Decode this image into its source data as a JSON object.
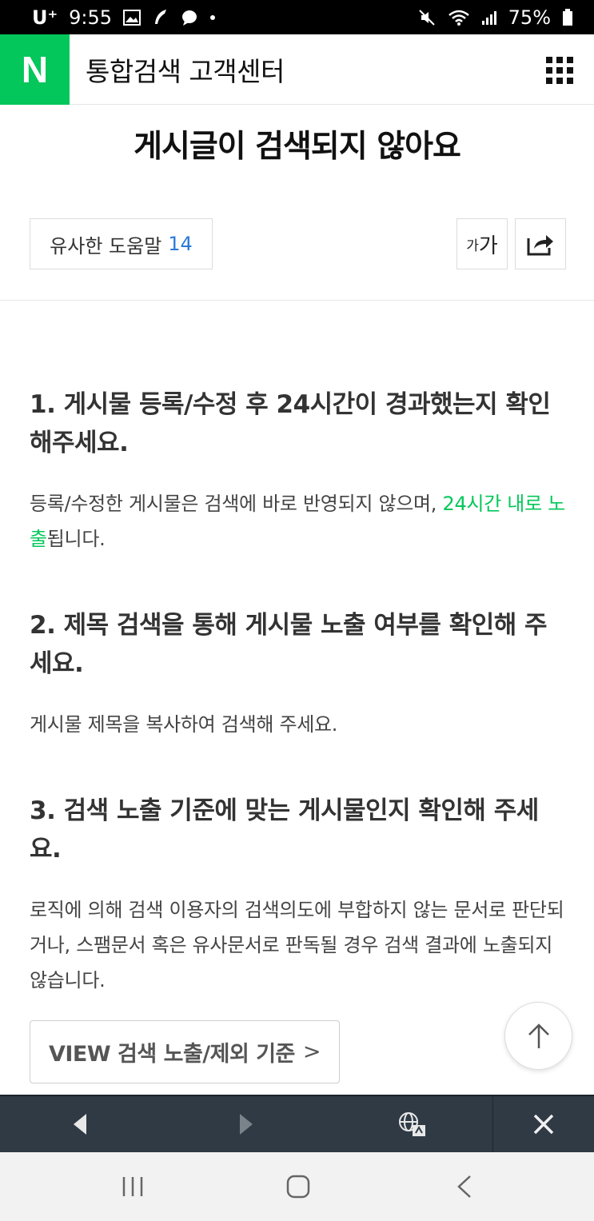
{
  "status_bar": {
    "carrier": "U⁺",
    "time": "9:55",
    "battery": "75%"
  },
  "header": {
    "logo": "N",
    "title": "통합검색 고객센터",
    "brand_color": "#03c75a"
  },
  "article": {
    "title": "게시글이 검색되지 않아요",
    "similar_label": "유사한 도움말",
    "similar_count": "14",
    "font_size_label_small": "가",
    "font_size_label_large": "가"
  },
  "sections": [
    {
      "title": "1. 게시물 등록/수정 후 24시간이 경과했는지 확인해주세요.",
      "body_pre": "등록/수정한 게시물은 검색에 바로 반영되지 않으며, ",
      "body_highlight": "24시간 내로 노출",
      "body_post": "됩니다."
    },
    {
      "title": "2. 제목 검색을 통해 게시물 노출 여부를 확인해 주세요.",
      "body": "게시물 제목을 복사하여 검색해 주세요."
    },
    {
      "title": "3. 검색 노출 기준에 맞는 게시물인지 확인해 주세요.",
      "body": "로직에 의해 검색 이용자의 검색의도에 부합하지 않는 문서로 판단되거나, 스팸문서 혹은 유사문서로 판독될 경우 검색 결과에 노출되지 않습니다."
    }
  ],
  "view_button": {
    "label": "VIEW 검색 노출/제외 기준",
    "chevron": ">"
  },
  "icons": {
    "menu": "grid-icon",
    "share": "share-icon",
    "scroll_top": "arrow-up-icon",
    "toolbar_back": "triangle-left-icon",
    "toolbar_forward": "triangle-right-icon",
    "toolbar_translate": "globe-icon",
    "toolbar_close": "close-icon",
    "nav_recent": "recent-apps-icon",
    "nav_home": "home-icon",
    "nav_back": "back-icon"
  }
}
